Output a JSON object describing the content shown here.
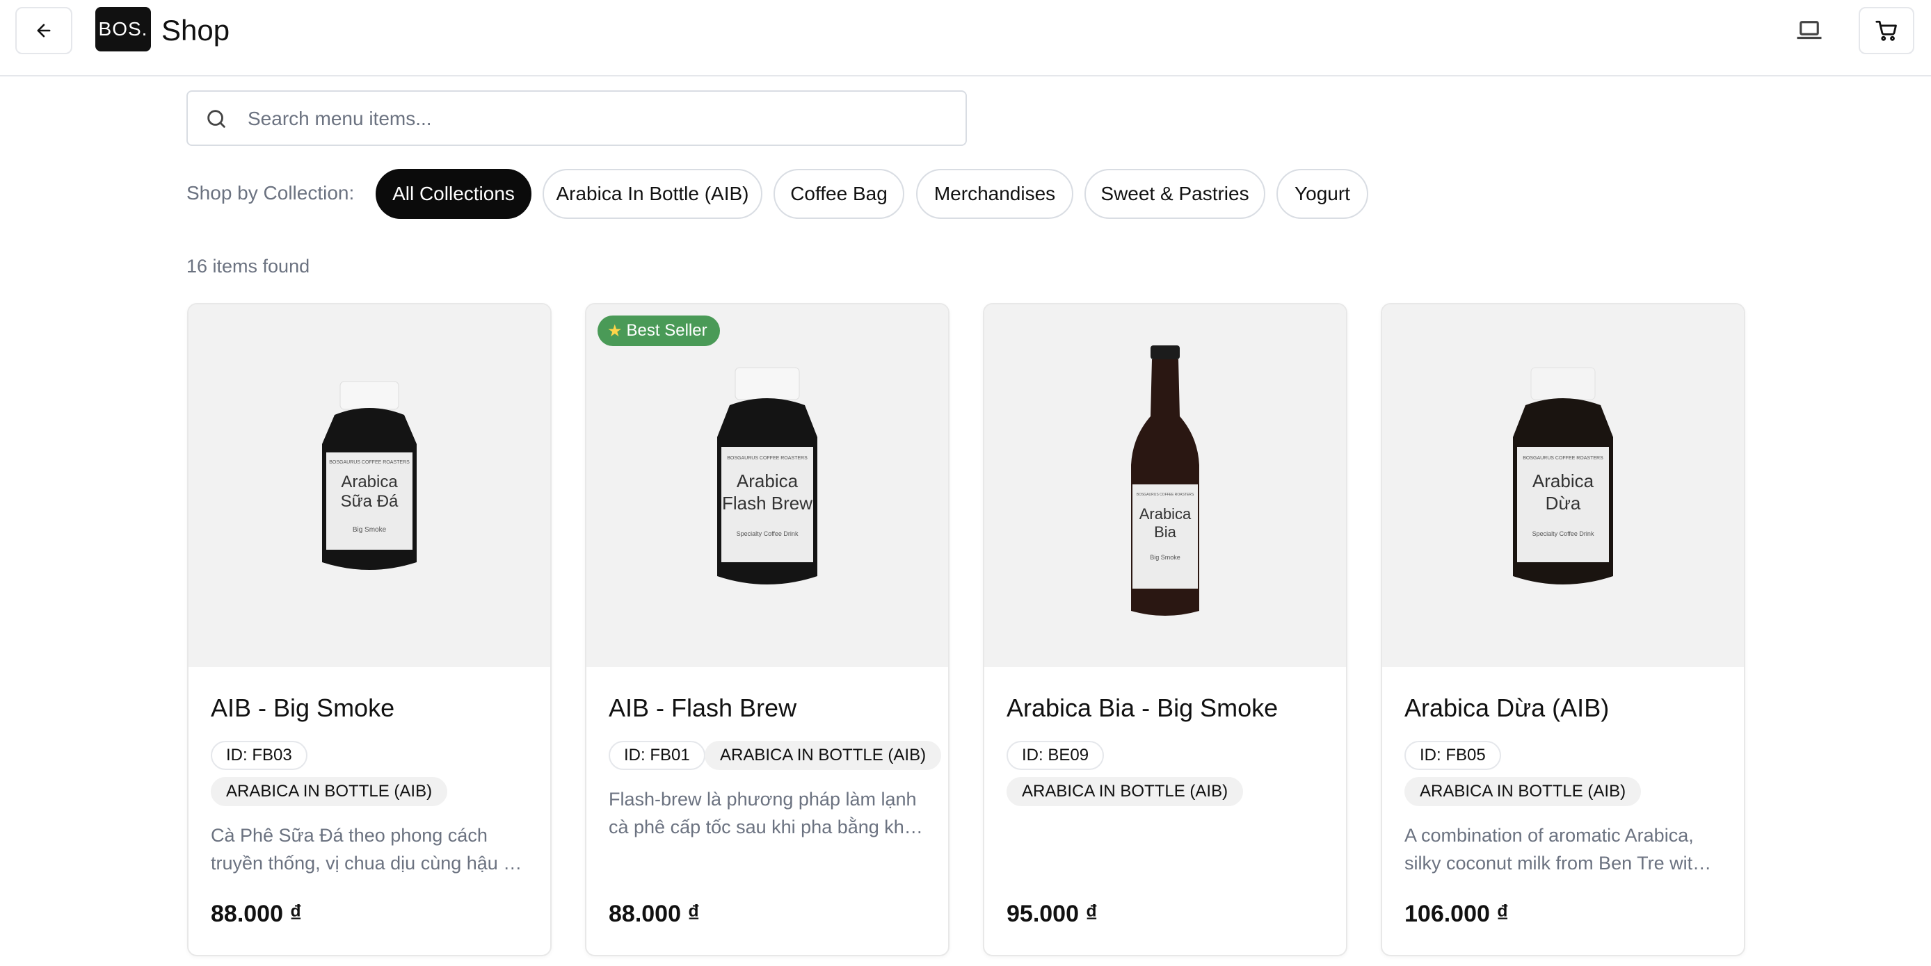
{
  "header": {
    "logo_text": "BOS.",
    "title": "Shop",
    "back_icon": "arrow-left-icon",
    "display_icon": "laptop-icon",
    "cart_icon": "cart-icon"
  },
  "search": {
    "placeholder": "Search menu items...",
    "value": ""
  },
  "collections": {
    "label": "Shop by Collection:",
    "chips": [
      "All Collections",
      "Arabica In Bottle (AIB)",
      "Coffee Bag",
      "Merchandises",
      "Sweet & Pastries",
      "Yogurt"
    ],
    "active": "All Collections"
  },
  "results": {
    "count_text": "16 items found"
  },
  "products": [
    {
      "name": "AIB - Big Smoke",
      "id": "ID: FB03",
      "collection": "ARABICA IN BOTTLE (AIB)",
      "desc_line1": "Cà Phê Sữa Đá theo phong cách",
      "desc_line2": "truyền thống, vị chua dịu cùng hậu …",
      "price": "88.000 ₫",
      "badge": "",
      "label_line1": "Arabica",
      "label_line2": "Sữa Đá",
      "brand": "BOSGAURUS COFFEE ROASTERS",
      "variant": "Big Smoke"
    },
    {
      "name": "AIB - Flash Brew",
      "id": "ID: FB01",
      "collection": "ARABICA IN BOTTLE (AIB)",
      "desc_line1": "Flash-brew là phương pháp làm lạnh",
      "desc_line2": "cà phê cấp tốc sau khi pha bằng kh…",
      "price": "88.000 ₫",
      "badge": "Best Seller",
      "label_line1": "Arabica",
      "label_line2": "Flash Brew",
      "brand": "BOSGAURUS COFFEE ROASTERS",
      "variant": "Specialty Coffee Drink"
    },
    {
      "name": "Arabica Bia - Big Smoke",
      "id": "ID: BE09",
      "collection": "ARABICA IN BOTTLE (AIB)",
      "desc_line1": "",
      "desc_line2": "",
      "price": "95.000 ₫",
      "badge": "",
      "label_line1": "Arabica",
      "label_line2": "Bia",
      "brand": "BOSGAURUS COFFEE ROASTERS",
      "variant": "Big Smoke"
    },
    {
      "name": "Arabica Dừa (AIB)",
      "id": "ID: FB05",
      "collection": "ARABICA IN BOTTLE (AIB)",
      "desc_line1": "A combination of aromatic Arabica,",
      "desc_line2": "silky coconut milk from Ben Tre wit…",
      "price": "106.000 ₫",
      "badge": "",
      "label_line1": "Arabica",
      "label_line2": "Dừa",
      "brand": "BOSGAURUS COFFEE ROASTERS",
      "variant": "Specialty Coffee Drink"
    }
  ],
  "colors": {
    "accent_dark": "#0b0b0b",
    "badge_green": "#4a9a57",
    "muted_text": "#6b7280"
  }
}
